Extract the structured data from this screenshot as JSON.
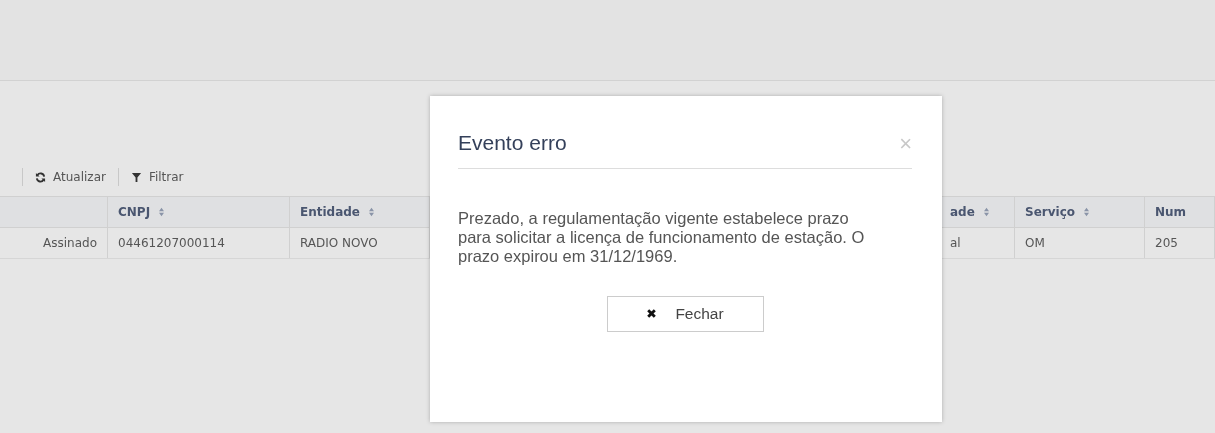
{
  "toolbar": [
    {
      "kind": "refresh",
      "label": "Atualizar"
    },
    {
      "kind": "filter",
      "label": "Filtrar"
    }
  ],
  "table": {
    "columns": [
      {
        "sortable": false
      },
      {
        "label": "CNPJ",
        "sortable": true
      },
      {
        "label": "Entidade",
        "sortable": true
      },
      {
        "label": "ade",
        "sortable": true
      },
      {
        "label": "Serviço",
        "sortable": true
      },
      {
        "label": "Num",
        "sortable": false
      }
    ],
    "rows": [
      [
        "Assinado",
        "04461207000114",
        "RADIO NOVO",
        "al",
        "OM",
        "205"
      ]
    ]
  },
  "dialog": {
    "title": "Evento erro",
    "close": "×",
    "message": "Prezado, a regulamentação vigente estabelece prazo para solicitar a licença de funcionamento de estação. O prazo expirou em 31/12/1969.",
    "button": "Fechar"
  }
}
